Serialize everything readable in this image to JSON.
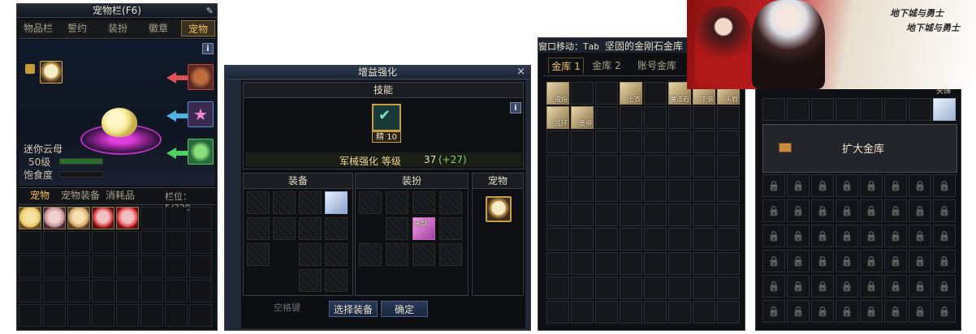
{
  "pet_window": {
    "title": "宠物栏(F6)",
    "tabs": [
      "物品栏",
      "誓约",
      "装扮",
      "徽章",
      "宠物"
    ],
    "pet_name": "迷你云母",
    "pet_level": "50级",
    "satiety_label": "饱食度",
    "info_label": "i",
    "bottom_tabs": [
      "宠物",
      "宠物装备",
      "消耗品"
    ],
    "slot_count": "栏位：5/320"
  },
  "enhance_window": {
    "title": "增益强化",
    "close": "×",
    "skill_header": "技能",
    "skill_badge": "精 10",
    "skill_name": "军械强化 等级",
    "skill_level": "37",
    "skill_bonus": "(+27)",
    "info_label": "i",
    "sections": {
      "equipment": "装备",
      "avatar": "装扮",
      "pet": "宠物"
    },
    "avatar_item_label": "头部",
    "buttons": {
      "select": "选择装备",
      "confirm": "确定"
    },
    "bg_text": "空格键"
  },
  "storage_window": {
    "header": "窗口移动：Tab",
    "title": "坚固的金刚石金库",
    "tabs": [
      "金库 1",
      "金库 2",
      "账号金库"
    ],
    "items": [
      "戒指",
      "上衣",
      "魔法石",
      "下装",
      "头肩",
      "耳环",
      "腰带"
    ]
  },
  "vault_window": {
    "corner_label": "头饰",
    "expand_button": "扩大金库"
  },
  "banner": {
    "logo_text_1": "地下城与勇士",
    "logo_text_2": "地下城与勇士"
  },
  "colors": {
    "accent_gold": "#f0c060",
    "panel_bg": "#0c0d0f",
    "title_bg": "#1b222d",
    "highlight_green": "#7fd36a",
    "button_blue": "#2a3a5a"
  }
}
